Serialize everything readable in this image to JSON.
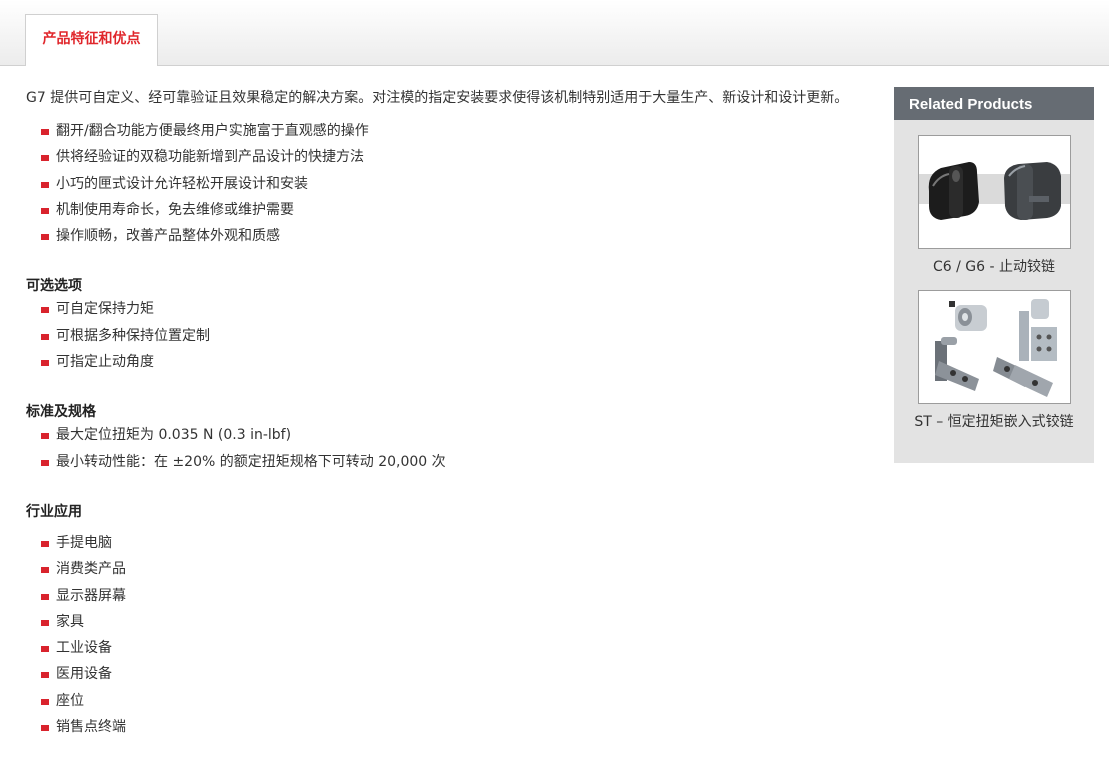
{
  "tabs": [
    {
      "label": "产品特征和优点",
      "active": true
    }
  ],
  "intro": "G7 提供可自定义、经可靠验证且效果稳定的解决方案。对注模的指定安装要求使得该机制特别适用于大量生产、新设计和设计更新。",
  "features": [
    "翻开/翻合功能方便最终用户实施富于直观感的操作",
    "供将经验证的双稳功能新增到产品设计的快捷方法",
    "小巧的匣式设计允许轻松开展设计和安装",
    "机制使用寿命长，免去维修或维护需要",
    "操作顺畅，改善产品整体外观和质感"
  ],
  "options": {
    "heading": "可选选项",
    "items": [
      "可自定保持力矩",
      "可根据多种保持位置定制",
      "可指定止动角度"
    ]
  },
  "specs": {
    "heading": "标准及规格",
    "items": [
      "最大定位扭矩为 0.035 N (0.3 in-lbf)",
      "最小转动性能：在 ±20% 的额定扭矩规格下可转动 20,000 次"
    ]
  },
  "industries": {
    "heading": "行业应用",
    "items": [
      "手提电脑",
      "消费类产品",
      "显示器屏幕",
      "家具",
      "工业设备",
      "医用设备",
      "座位",
      "销售点终端"
    ]
  },
  "sidebar": {
    "title": "Related Products",
    "products": [
      {
        "label": "C6 / G6 - 止动铰链",
        "image": "black-detent-hinges-image"
      },
      {
        "label": "ST – 恒定扭矩嵌入式铰链",
        "image": "metal-torque-hinges-image"
      }
    ]
  },
  "colors": {
    "accent_red": "#d9232d",
    "tab_text": "#e0262b",
    "sidebar_header": "#666c73",
    "sidebar_bg": "#e3e3e3"
  }
}
